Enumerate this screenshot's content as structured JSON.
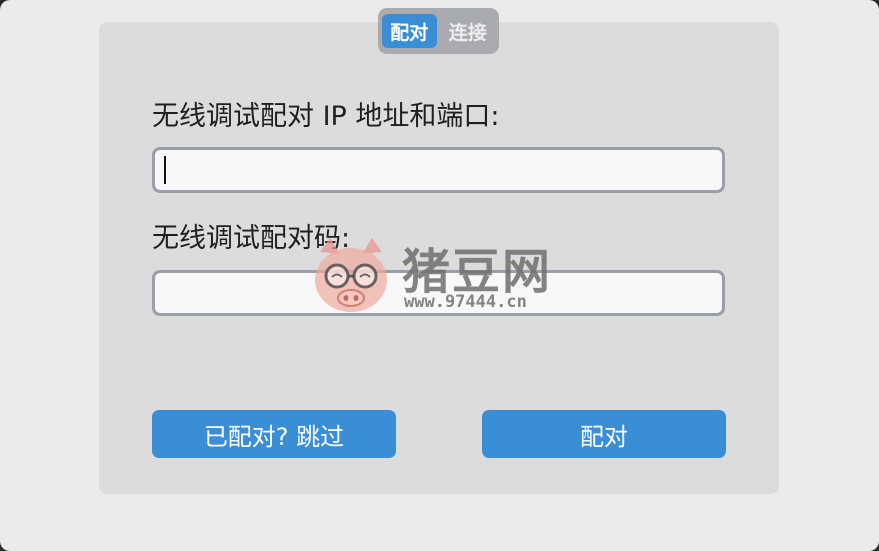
{
  "tabs": [
    {
      "label": "配对",
      "active": true
    },
    {
      "label": "连接",
      "active": false
    }
  ],
  "form": {
    "ip_label": "无线调试配对 IP 地址和端口:",
    "ip_value": "",
    "code_label": "无线调试配对码:",
    "code_value": ""
  },
  "buttons": {
    "skip_label": "已配对? 跳过",
    "pair_label": "配对"
  },
  "watermark": {
    "text": "猪豆网",
    "url": "www.97444.cn"
  },
  "colors": {
    "accent": "#3a8ed6",
    "panel": "#dcdcdd",
    "window": "#ebebeb"
  }
}
